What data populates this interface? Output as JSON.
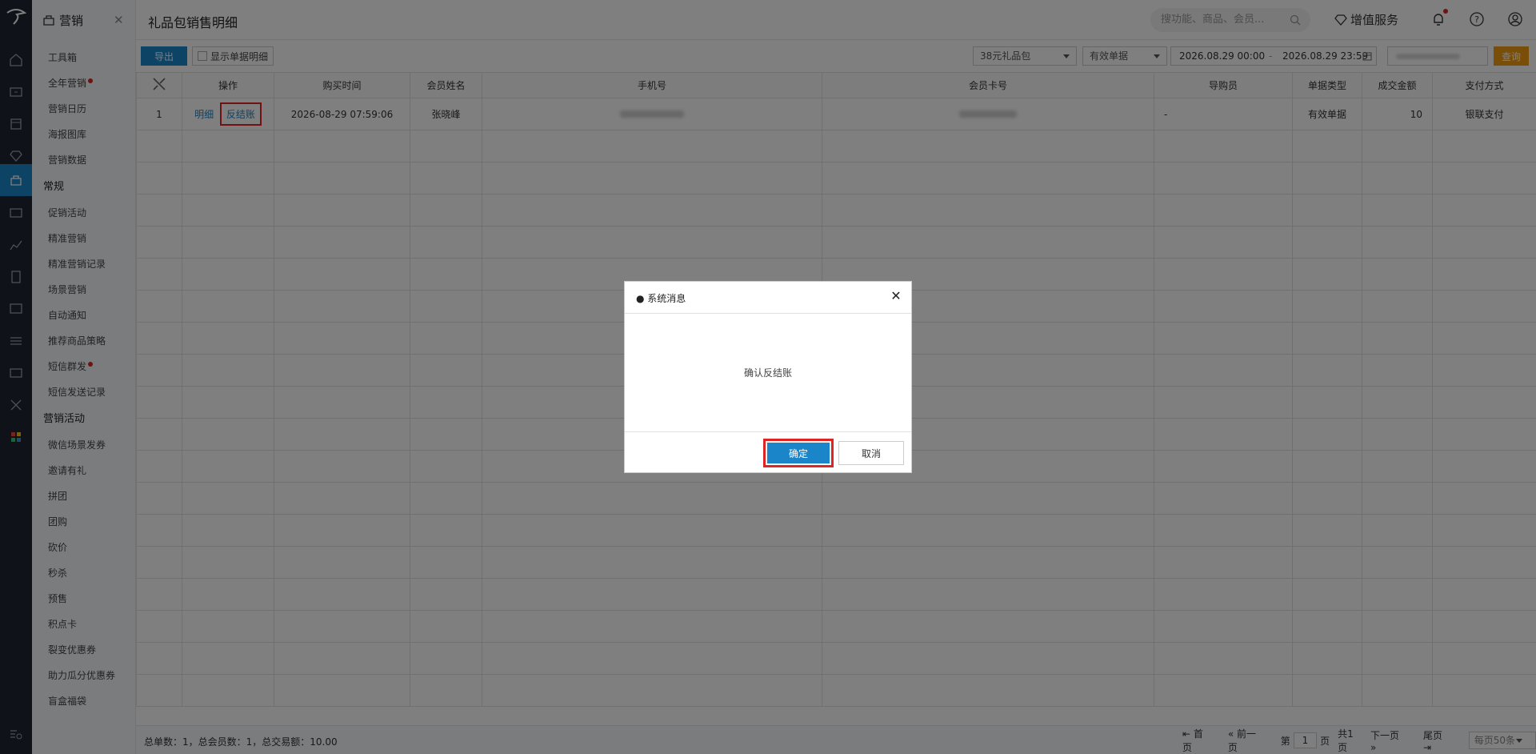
{
  "menu": {
    "title": "营销",
    "items_top": [
      "工具箱",
      "全年营销",
      "营销日历",
      "海报图库",
      "营销数据"
    ],
    "group_regular": "常规",
    "items_regular": [
      "促销活动",
      "精准营销",
      "精准营销记录",
      "场景营销",
      "自动通知",
      "推荐商品策略",
      "短信群发",
      "短信发送记录"
    ],
    "group_activity": "营销活动",
    "items_activity": [
      "微信场景发券",
      "邀请有礼",
      "拼团",
      "团购",
      "砍价",
      "秒杀",
      "预售",
      "积点卡",
      "裂变优惠券",
      "助力瓜分优惠券",
      "盲盒福袋"
    ]
  },
  "header": {
    "page_title": "礼品包销售明细",
    "search_placeholder": "搜功能、商品、会员...",
    "value_added": "增值服务"
  },
  "toolbar": {
    "export": "导出",
    "show_detail": "显示单据明细",
    "gift_select": "38元礼品包",
    "doc_select": "有效单据",
    "date_start": "2026.08.29 00:00",
    "date_sep": "-",
    "date_end": "2026.08.29 23:59",
    "query": "查询"
  },
  "table": {
    "headers": [
      "",
      "操作",
      "购买时间",
      "会员姓名",
      "手机号",
      "会员卡号",
      "导购员",
      "单据类型",
      "成交金额",
      "支付方式"
    ],
    "row": {
      "index": "1",
      "action_detail": "明细",
      "action_reverse": "反结账",
      "time": "2026-08-29 07:59:06",
      "name": "张晓峰",
      "guide": "-",
      "type": "有效单据",
      "amount": "10",
      "payment": "银联支付"
    }
  },
  "footer": {
    "summary": "总单数：1，总会员数：1，总交易额：10.00",
    "first": "首页",
    "prev": "前一页",
    "page_prefix": "第",
    "page_num": "1",
    "page_suffix": "页",
    "total_pages": "共1页",
    "next": "下一页",
    "last": "尾页",
    "per_page": "每页50条"
  },
  "dialog": {
    "title": "● 系统消息",
    "message": "确认反结账",
    "ok": "确定",
    "cancel": "取消"
  },
  "colors": {
    "primary": "#1a86c9",
    "query": "#f39c12",
    "highlight": "#e02424",
    "rail": "#1f2530"
  }
}
